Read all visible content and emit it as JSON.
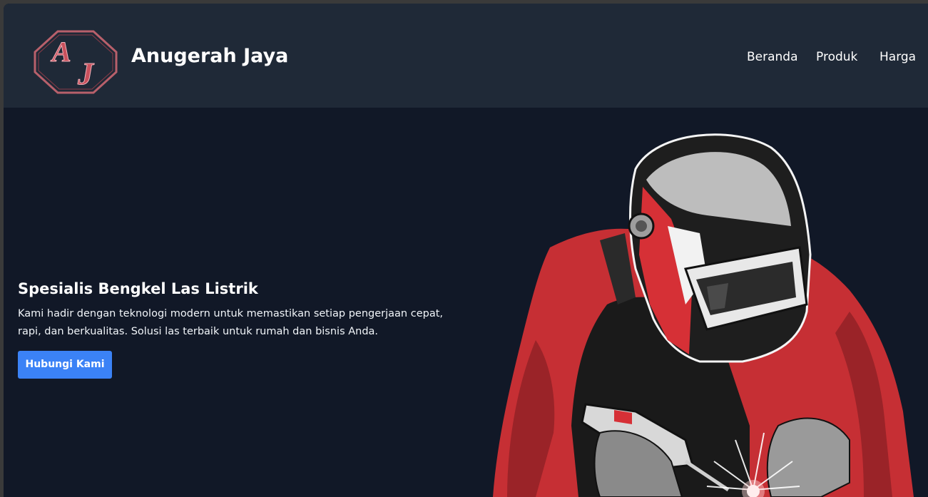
{
  "header": {
    "logo_text": "AJ",
    "brand": "Anugerah Jaya",
    "nav": [
      {
        "label": "Beranda"
      },
      {
        "label": "Produk"
      },
      {
        "label": "Harga"
      }
    ]
  },
  "hero": {
    "title": "Spesialis Bengkel Las Listrik",
    "description": "Kami hadir dengan teknologi modern untuk memastikan setiap pengerjaan cepat, rapi, dan berkualitas. Solusi las terbaik untuk rumah dan bisnis Anda.",
    "cta_label": "Hubungi Kami",
    "illustration": "welder-illustration"
  },
  "colors": {
    "page_bg": "#111827",
    "header_bg": "#1f2937",
    "accent": "#3b82f6",
    "logo_red": "#c0505a"
  }
}
